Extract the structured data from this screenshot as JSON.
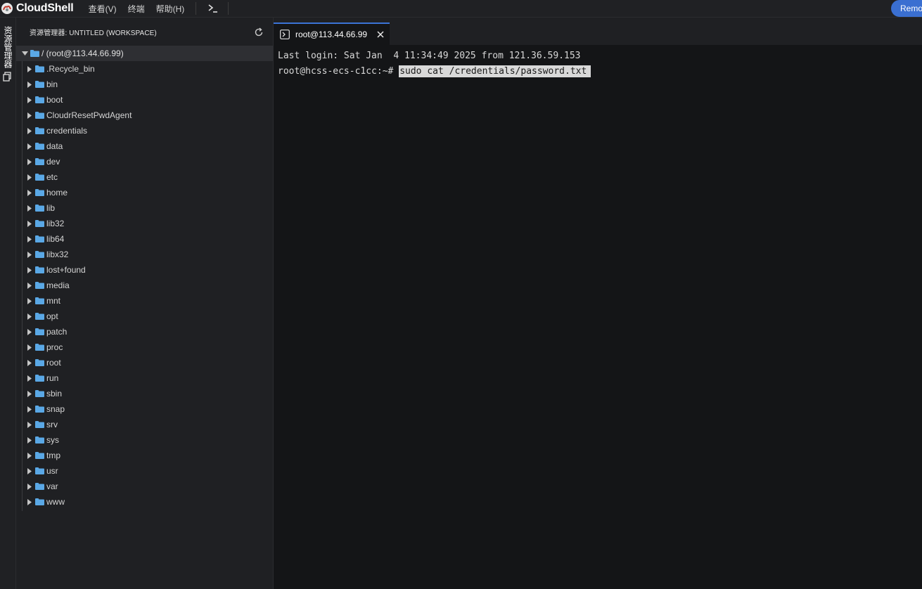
{
  "app": {
    "title": "CloudShell",
    "menu": [
      "查看(V)",
      "终端",
      "帮助(H)"
    ],
    "remote_label": "Remote"
  },
  "activity": {
    "explorer_label": "资源管理器"
  },
  "explorer": {
    "title": "资源管理器: UNTITLED (WORKSPACE)",
    "root_label": "/ (root@113.44.66.99)",
    "items": [
      ".Recycle_bin",
      "bin",
      "boot",
      "CloudrResetPwdAgent",
      "credentials",
      "data",
      "dev",
      "etc",
      "home",
      "lib",
      "lib32",
      "lib64",
      "libx32",
      "lost+found",
      "media",
      "mnt",
      "opt",
      "patch",
      "proc",
      "root",
      "run",
      "sbin",
      "snap",
      "srv",
      "sys",
      "tmp",
      "usr",
      "var",
      "www"
    ]
  },
  "terminal": {
    "tab_label": "root@113.44.66.99",
    "last_login": "Last login: Sat Jan  4 11:34:49 2025 from 121.36.59.153",
    "prompt": "root@hcss-ecs-c1cc:~# ",
    "command": "sudo cat /credentials/password.txt"
  },
  "colors": {
    "accent": "#3b73d6",
    "folder": "#5aa8e6",
    "background": "#141517",
    "sidebar": "#1f2023"
  }
}
